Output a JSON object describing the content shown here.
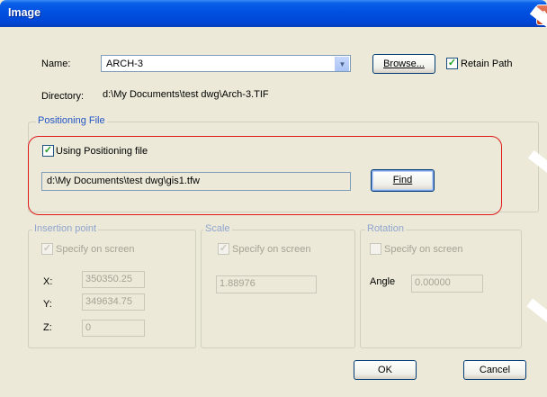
{
  "window": {
    "title": "Image",
    "close_glyph": "X"
  },
  "name_row": {
    "label": "Name:",
    "value": "ARCH-3",
    "browse_label": "Browse...",
    "retain_path_label": "Retain Path",
    "retain_path_checked": true
  },
  "directory": {
    "label": "Directory:",
    "value": "d:\\My Documents\\test dwg\\Arch-3.TIF"
  },
  "positioning": {
    "legend": "Positioning File",
    "using_label": "Using Positioning file",
    "using_checked": true,
    "path": "d:\\My Documents\\test dwg\\gis1.tfw",
    "find_label": "Find"
  },
  "insertion": {
    "legend": "Insertion point",
    "specify_label": "Specify on screen",
    "specify_checked": true,
    "x_label": "X:",
    "x_value": "350350.25",
    "y_label": "Y:",
    "y_value": "349634.75",
    "z_label": "Z:",
    "z_value": "0"
  },
  "scale": {
    "legend": "Scale",
    "specify_label": "Specify on screen",
    "specify_checked": true,
    "value": "1.88976"
  },
  "rotation": {
    "legend": "Rotation",
    "specify_label": "Specify on screen",
    "specify_checked": false,
    "angle_label": "Angle",
    "angle_value": "0.00000"
  },
  "buttons": {
    "ok": "OK",
    "cancel": "Cancel"
  },
  "icons": {
    "check": "✓",
    "dropdown": "▼"
  },
  "colors": {
    "title_bar": "#0050df",
    "highlight": "#e01818",
    "legend": "#2255c4"
  }
}
